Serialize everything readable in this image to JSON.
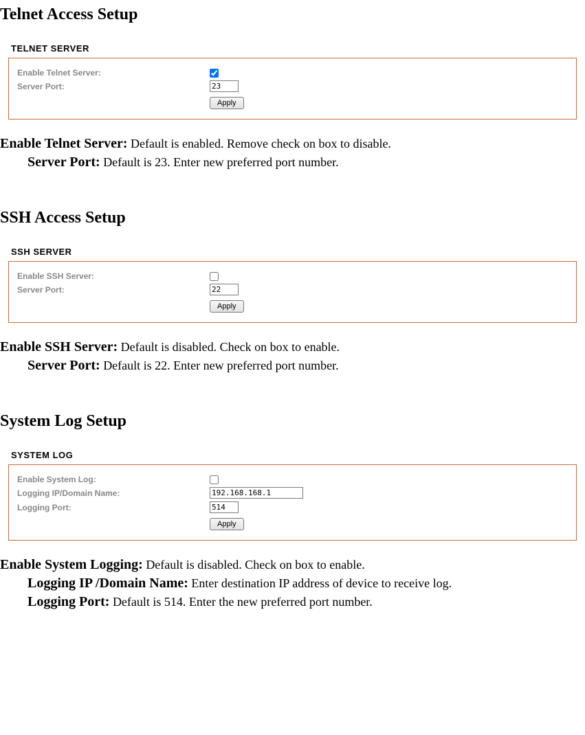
{
  "sections": {
    "telnet": {
      "heading": "Telnet Access Setup",
      "panel_title": "TELNET SERVER",
      "rows": {
        "enable_label": "Enable Telnet Server:",
        "enable_checked": true,
        "port_label": "Server Port:",
        "port_value": "23",
        "apply_label": "Apply"
      },
      "desc": [
        {
          "strong": "Enable Telnet Server:",
          "text": " Default is enabled. Remove check on box to disable.",
          "indent": false
        },
        {
          "strong": "Server Port:",
          "text": " Default is 23. Enter new preferred port number.",
          "indent": true
        }
      ]
    },
    "ssh": {
      "heading": "SSH Access Setup",
      "panel_title": "SSH SERVER",
      "rows": {
        "enable_label": "Enable SSH Server:",
        "enable_checked": false,
        "port_label": "Server Port:",
        "port_value": "22",
        "apply_label": "Apply"
      },
      "desc": [
        {
          "strong": "Enable SSH Server:",
          "text": " Default is disabled. Check on box to enable.",
          "indent": false
        },
        {
          "strong": "Server Port:",
          "text": " Default is 22. Enter new preferred port number.",
          "indent": true
        }
      ]
    },
    "syslog": {
      "heading": "System Log Setup",
      "panel_title": "SYSTEM LOG",
      "rows": {
        "enable_label": "Enable System Log:",
        "enable_checked": false,
        "ip_label": "Logging IP/Domain Name:",
        "ip_value": "192.168.168.1",
        "port_label": "Logging Port:",
        "port_value": "514",
        "apply_label": "Apply"
      },
      "desc": [
        {
          "strong": "Enable System Logging:",
          "text": " Default is disabled. Check on box to enable.",
          "indent": false
        },
        {
          "strong": "Logging IP /Domain Name:",
          "text": " Enter destination IP address of device to receive log.",
          "indent": true
        },
        {
          "strong": "Logging Port:",
          "text": " Default is 514. Enter the new preferred port number.",
          "indent": true
        }
      ]
    }
  }
}
